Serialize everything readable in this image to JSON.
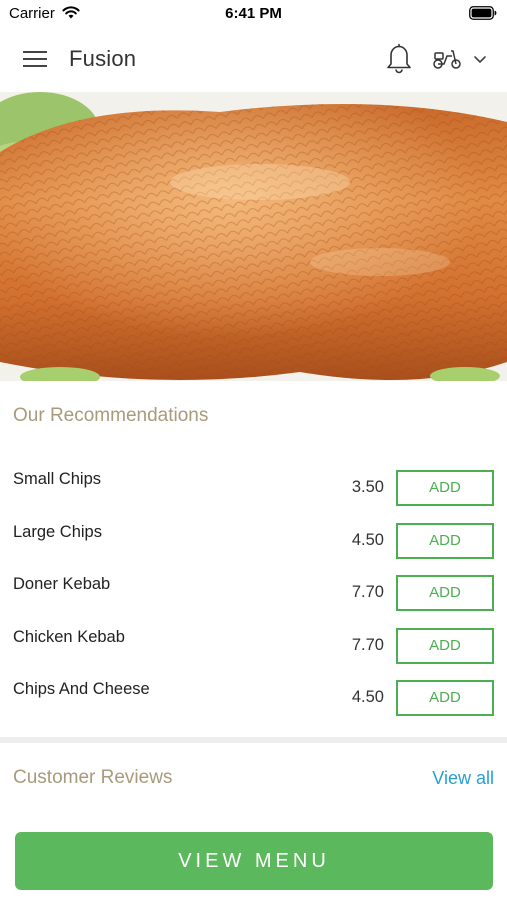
{
  "status_bar": {
    "carrier": "Carrier",
    "time": "6:41 PM"
  },
  "header": {
    "title": "Fusion",
    "icons": [
      "menu-icon",
      "bell-icon",
      "scooter-icon",
      "chevron-down-icon"
    ]
  },
  "hero": {
    "image_subject": "roast-duck-photo"
  },
  "recommendations": {
    "title": "Our Recommendations",
    "items": [
      {
        "name": "Small Chips",
        "price": "3.50",
        "add_label": "ADD"
      },
      {
        "name": "Large Chips",
        "price": "4.50",
        "add_label": "ADD"
      },
      {
        "name": "Doner Kebab",
        "price": "7.70",
        "add_label": "ADD"
      },
      {
        "name": "Chicken Kebab",
        "price": "7.70",
        "add_label": "ADD"
      },
      {
        "name": "Chips And Cheese",
        "price": "4.50",
        "add_label": "ADD"
      }
    ]
  },
  "reviews": {
    "title": "Customer Reviews",
    "view_all_label": "View all"
  },
  "footer": {
    "view_menu_label": "VIEW MENU"
  },
  "colors": {
    "accent_green": "#5cb85c",
    "button_border_green": "#4caf50",
    "section_title": "#a89a7c",
    "link_blue": "#2a9fd6"
  }
}
